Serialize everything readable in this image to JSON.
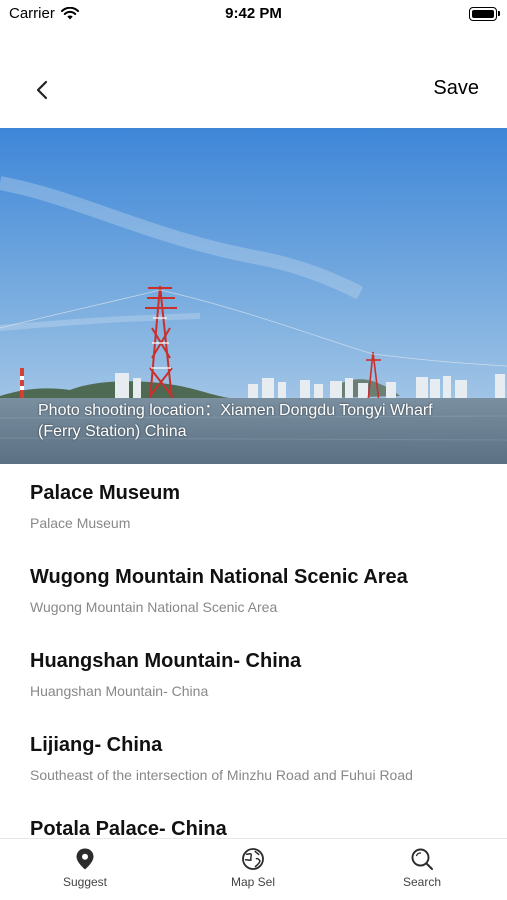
{
  "status_bar": {
    "carrier": "Carrier",
    "time": "9:42 PM"
  },
  "nav": {
    "save_label": "Save"
  },
  "hero": {
    "caption": "Photo shooting location：Xiamen Dongdu Tongyi Wharf (Ferry Station) China"
  },
  "places": [
    {
      "title": "Palace Museum",
      "subtitle": "Palace Museum"
    },
    {
      "title": "Wugong Mountain National Scenic Area",
      "subtitle": "Wugong Mountain National Scenic Area"
    },
    {
      "title": "Huangshan Mountain- China",
      "subtitle": "Huangshan Mountain- China"
    },
    {
      "title": "Lijiang- China",
      "subtitle": "Southeast of the intersection of Minzhu Road and Fuhui Road"
    },
    {
      "title": "Potala Palace- China",
      "subtitle": ""
    }
  ],
  "tabs": [
    {
      "label": "Suggest",
      "icon": "location-pin-icon"
    },
    {
      "label": "Map Sel",
      "icon": "globe-icon"
    },
    {
      "label": "Search",
      "icon": "search-icon"
    }
  ],
  "colors": {
    "sky_top": "#3f86d6",
    "sky_bottom": "#a9c9e6",
    "water": "#6b8193",
    "tower": "#c9302c"
  }
}
